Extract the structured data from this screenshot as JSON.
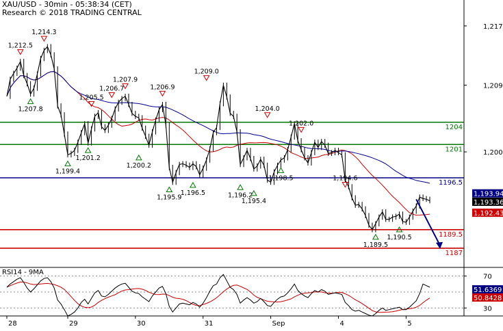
{
  "header": {
    "title": "XAU/USD - 30min - 05:38:34 (CET)",
    "credit": "Research © 2018 TRADING CENTRAL"
  },
  "chart_data": {
    "type": "line",
    "instrument": "XAU/USD",
    "timeframe": "30min",
    "x_axis": {
      "ticks": [
        {
          "label": "28",
          "bar": 0
        },
        {
          "label": "29",
          "bar": 18
        },
        {
          "label": "30",
          "bar": 38
        },
        {
          "label": "31",
          "bar": 58
        },
        {
          "label": "Sep",
          "bar": 78
        },
        {
          "label": "4",
          "bar": 98
        },
        {
          "label": "5",
          "bar": 118
        }
      ],
      "bar_count": 126
    },
    "price_axis": {
      "range": [
        1184.5,
        1220.5
      ],
      "ticks": [
        1217,
        1209,
        1200
      ],
      "tick_labels": [
        "1,217",
        "1,209",
        "1,200"
      ]
    },
    "price_series": {
      "name": "XAU/USD",
      "color": "#000000",
      "close": [
        1207.5,
        1209.8,
        1210.6,
        1211.3,
        1212.2,
        1210.3,
        1209.2,
        1207.8,
        1208.6,
        1210.5,
        1212.6,
        1213.7,
        1214.2,
        1213.1,
        1211.2,
        1206.2,
        1205.0,
        1202.4,
        1199.6,
        1199.8,
        1200.2,
        1201.3,
        1202.6,
        1203.8,
        1201.2,
        1203.1,
        1204.8,
        1205.3,
        1203.4,
        1202.9,
        1203.6,
        1204.5,
        1205.8,
        1206.7,
        1207.2,
        1207.5,
        1206.4,
        1205.2,
        1204.8,
        1204.6,
        1203.2,
        1202.1,
        1200.9,
        1202.7,
        1204.3,
        1205.7,
        1206.4,
        1203.6,
        1197.9,
        1195.9,
        1197.2,
        1198.3,
        1198.4,
        1198.2,
        1197.9,
        1198.4,
        1198.0,
        1196.9,
        1197.8,
        1198.9,
        1200.4,
        1202.6,
        1203.3,
        1206.5,
        1209.0,
        1207.4,
        1205.2,
        1204.8,
        1202.7,
        1198.3,
        1199.2,
        1200.2,
        1199.1,
        1197.7,
        1198.1,
        1199.0,
        1198.2,
        1196.2,
        1195.9,
        1197.3,
        1198.2,
        1198.9,
        1199.2,
        1200.3,
        1202.0,
        1203.8,
        1201.5,
        1200.3,
        1199.2,
        1198.5,
        1199.9,
        1201.3,
        1200.6,
        1201.4,
        1200.9,
        1199.8,
        1199.9,
        1200.2,
        1199.9,
        1199.6,
        1196.2,
        1195.3,
        1193.8,
        1192.8,
        1192.9,
        1192.3,
        1191.4,
        1190.1,
        1189.5,
        1190.3,
        1191.2,
        1191.9,
        1190.9,
        1190.9,
        1191.2,
        1191.3,
        1191.6,
        1190.6,
        1190.5,
        1191.2,
        1192.0,
        1192.7,
        1193.9,
        1193.7,
        1193.6,
        1193.4
      ]
    },
    "moving_averages": [
      {
        "color": "#cc0000",
        "period": 20
      },
      {
        "color": "#000099",
        "period": 50
      }
    ],
    "horizontal_levels": [
      {
        "value": 1204,
        "label": "1204",
        "color": "#007700"
      },
      {
        "value": 1201,
        "label": "1201",
        "color": "#007700"
      },
      {
        "value": 1196.5,
        "label": "1196.5",
        "color": "#000080"
      },
      {
        "value": 1189.5,
        "label": "1189.5",
        "color": "#cc0000"
      },
      {
        "value": 1187,
        "label": "1187",
        "color": "#cc0000"
      }
    ],
    "price_tags": [
      {
        "value": 1193.94,
        "label": "1,193.94",
        "bg": "#000080"
      },
      {
        "value": 1193.36,
        "label": "1,193.36",
        "bg": "#000000"
      },
      {
        "value": 1192.43,
        "label": "1,192.43",
        "bg": "#cc0000"
      }
    ],
    "swing_markers": [
      {
        "bar": 4,
        "value": 1212.5,
        "label": "1,212.5",
        "kind": "high"
      },
      {
        "bar": 11,
        "value": 1214.3,
        "label": "1,214.3",
        "kind": "high"
      },
      {
        "bar": 7,
        "value": 1207.8,
        "label": "1,207.8",
        "kind": "low"
      },
      {
        "bar": 18,
        "value": 1199.4,
        "label": "1,199.4",
        "kind": "low"
      },
      {
        "bar": 24,
        "value": 1201.2,
        "label": "1,201.2",
        "kind": "low"
      },
      {
        "bar": 25,
        "value": 1205.5,
        "label": "1,205.5",
        "kind": "high"
      },
      {
        "bar": 31,
        "value": 1206.7,
        "label": "1,206.7",
        "kind": "high"
      },
      {
        "bar": 35,
        "value": 1207.9,
        "label": "1,207.9",
        "kind": "high"
      },
      {
        "bar": 39,
        "value": 1200.2,
        "label": "1,200.2",
        "kind": "low"
      },
      {
        "bar": 46,
        "value": 1206.9,
        "label": "1,206.9",
        "kind": "high"
      },
      {
        "bar": 48,
        "value": 1195.9,
        "label": "1,195.9",
        "kind": "low"
      },
      {
        "bar": 55,
        "value": 1196.5,
        "label": "1,196.5",
        "kind": "low"
      },
      {
        "bar": 59,
        "value": 1209.0,
        "label": "1,209.0",
        "kind": "high"
      },
      {
        "bar": 69,
        "value": 1196.2,
        "label": "1,196.2",
        "kind": "low"
      },
      {
        "bar": 73,
        "value": 1195.4,
        "label": "1,195.4",
        "kind": "low"
      },
      {
        "bar": 77,
        "value": 1204.0,
        "label": "1,204.0",
        "kind": "high"
      },
      {
        "bar": 81,
        "value": 1198.5,
        "label": "1,198.5",
        "kind": "low"
      },
      {
        "bar": 87,
        "value": 1202.0,
        "label": "1,202.0",
        "kind": "high"
      },
      {
        "bar": 100,
        "value": 1194.6,
        "label": "1,194.6",
        "kind": "high"
      },
      {
        "bar": 109,
        "value": 1189.5,
        "label": "1,189.5",
        "kind": "low"
      },
      {
        "bar": 116,
        "value": 1190.5,
        "label": "1,190.5",
        "kind": "low"
      }
    ],
    "forecast_arrow": {
      "from_bar": 121,
      "from_value": 1193.6,
      "to_bar": 125,
      "to_value": 1187,
      "color": "#000080"
    },
    "rsi_panel": {
      "label": "RSI14 - 9MA",
      "range": [
        20,
        80
      ],
      "ticks": [
        70,
        30
      ],
      "tick_labels": [
        "70",
        "30"
      ],
      "dotted_levels": [
        70,
        50,
        30
      ],
      "rsi": [
        56,
        60,
        63,
        66,
        68,
        62,
        55,
        50,
        54,
        59,
        64,
        67,
        68,
        63,
        55,
        40,
        35,
        28,
        20,
        22,
        25,
        30,
        37,
        41,
        35,
        42,
        49,
        52,
        45,
        44,
        47,
        51,
        55,
        58,
        60,
        61,
        56,
        51,
        49,
        48,
        44,
        41,
        38,
        45,
        50,
        55,
        57,
        48,
        32,
        25,
        30,
        35,
        36,
        35,
        34,
        37,
        35,
        31,
        36,
        43,
        51,
        58,
        60,
        68,
        72,
        64,
        56,
        53,
        47,
        36,
        40,
        43,
        40,
        36,
        38,
        42,
        38,
        33,
        32,
        37,
        41,
        44,
        45,
        49,
        54,
        60,
        52,
        48,
        45,
        43,
        48,
        52,
        50,
        53,
        51,
        47,
        48,
        49,
        48,
        47,
        37,
        33,
        28,
        26,
        27,
        25,
        23,
        21,
        20,
        23,
        27,
        30,
        27,
        28,
        29,
        30,
        31,
        28,
        28,
        31,
        35,
        39,
        48,
        60,
        58,
        56
      ],
      "values": [
        {
          "label": "51.6369",
          "value": 51.6369,
          "bg": "#000080"
        },
        {
          "label": "50.8428",
          "value": 50.8428,
          "bg": "#cc0000"
        }
      ]
    }
  }
}
